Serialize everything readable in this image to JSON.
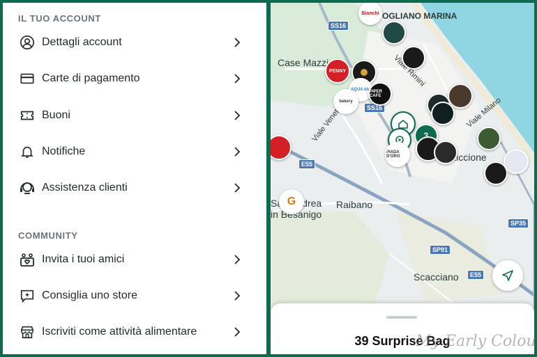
{
  "account_section": {
    "header": "IL TUO ACCOUNT",
    "items": [
      {
        "label": "Dettagli account",
        "icon": "user-circle-icon"
      },
      {
        "label": "Carte di pagamento",
        "icon": "credit-card-icon"
      },
      {
        "label": "Buoni",
        "icon": "ticket-icon"
      },
      {
        "label": "Notifiche",
        "icon": "bell-icon"
      },
      {
        "label": "Assistenza clienti",
        "icon": "headset-icon"
      }
    ]
  },
  "community_section": {
    "header": "COMMUNITY",
    "items": [
      {
        "label": "Invita i tuoi amici",
        "icon": "friends-heart-icon"
      },
      {
        "label": "Consiglia uno store",
        "icon": "suggest-store-icon"
      },
      {
        "label": "Iscriviti come attività alimentare",
        "icon": "storefront-icon"
      }
    ]
  },
  "map": {
    "place_labels": [
      "POGLIANO MARINA",
      "Case Mazzi",
      "Viale Rimini",
      "Viale Veneto",
      "Viale Milano",
      "Riccione",
      "San Andrea in Besanigo",
      "Raibano",
      "Scacciano"
    ],
    "road_badges": [
      "SS16",
      "SS16",
      "E55",
      "SP35",
      "SP91",
      "E55"
    ],
    "pins": [
      "PENNY",
      "Autogrill",
      "Bianchi",
      "PIPER CAFE",
      "AQUA blu",
      "bakery",
      "PIADA D'ORO",
      "G"
    ],
    "accent_color": "#0d6b4f"
  },
  "bottom_sheet": {
    "title": "39 Surprise Bag"
  },
  "watermark": "My Early Colours"
}
